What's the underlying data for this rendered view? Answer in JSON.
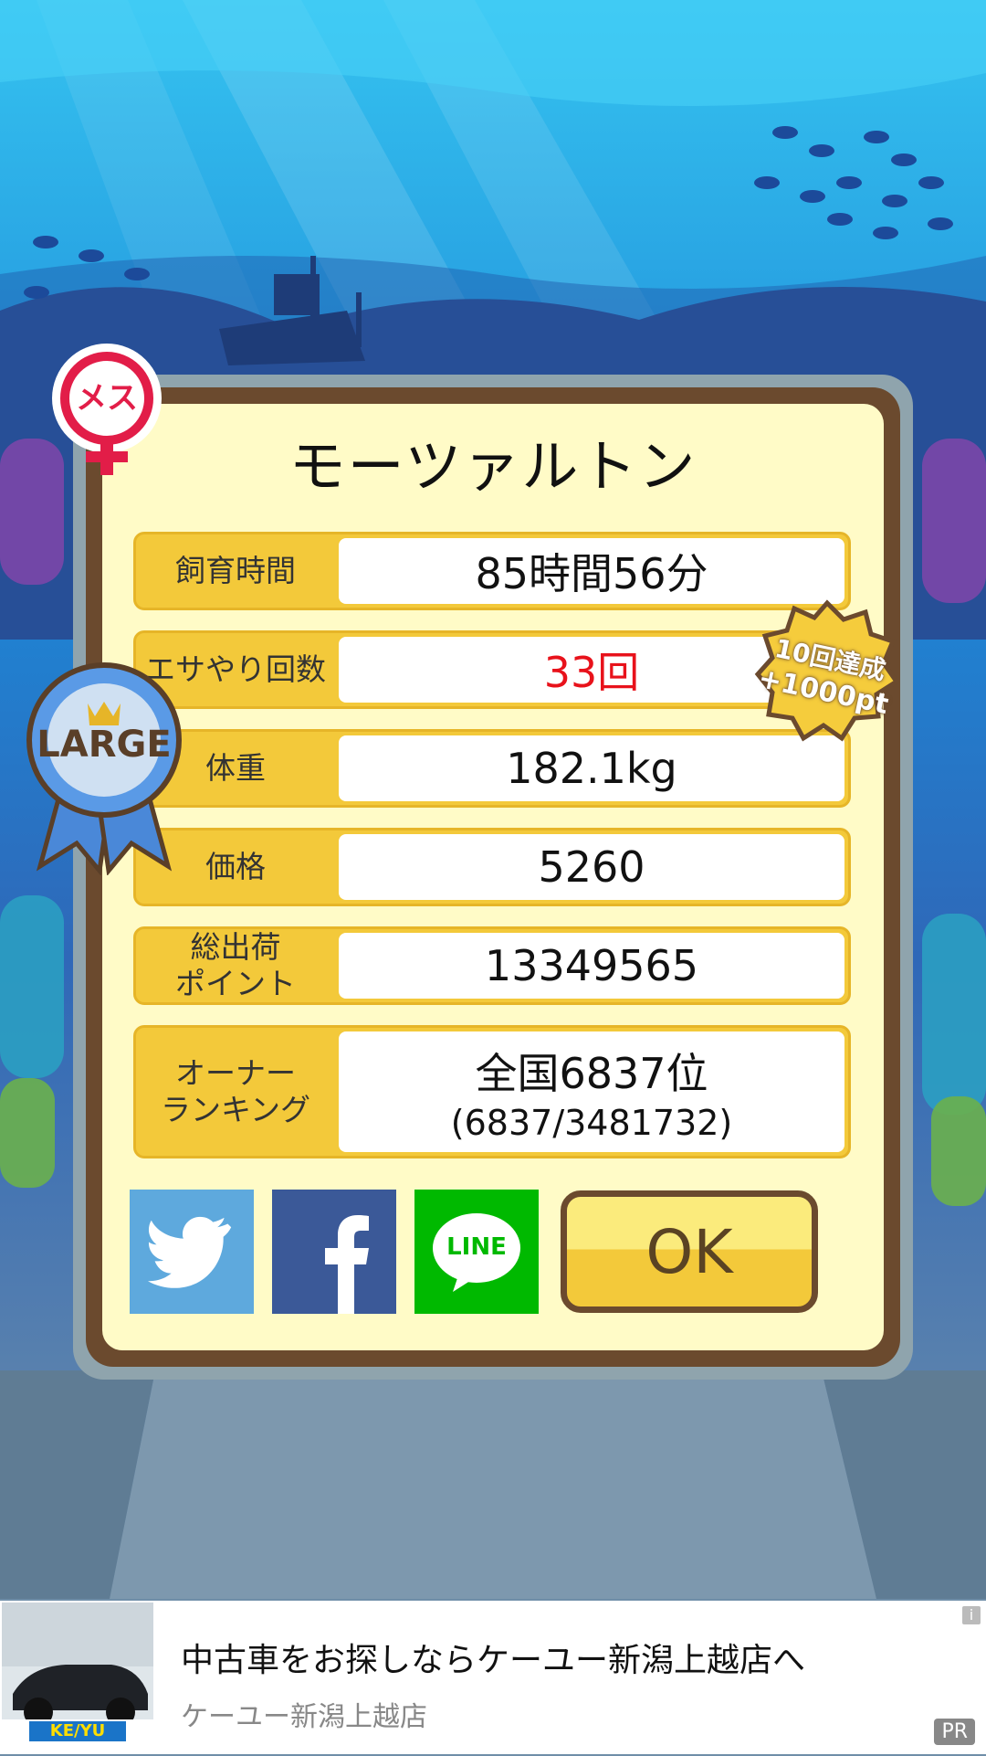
{
  "fish": {
    "name": "モーツァルトン",
    "gender_badge": "メス",
    "size_badge": "LARGE"
  },
  "bonus_badge": {
    "line1": "10回達成",
    "line2": "+1000pt"
  },
  "stats": [
    {
      "label": "飼育時間",
      "value": "85時間56分"
    },
    {
      "label": "エサやり回数",
      "value": "33回"
    },
    {
      "label": "体重",
      "value": "182.1kg"
    },
    {
      "label": "価格",
      "value": "5260"
    },
    {
      "label_line1": "総出荷",
      "label_line2": "ポイント",
      "value": "13349565"
    },
    {
      "label_line1": "オーナー",
      "label_line2": "ランキング",
      "value": "全国6837位",
      "value_sub": "(6837/3481732)"
    }
  ],
  "share": {
    "twitter_icon": "twitter-bird-icon",
    "facebook_icon": "facebook-f-icon",
    "line_icon": "line-icon",
    "line_text": "LINE"
  },
  "ok_label": "OK",
  "ad": {
    "headline": "中古車をお探しならケーユー新潟上越店へ",
    "advertiser": "ケーユー新潟上越店",
    "logo_text": "KE/YU",
    "pr_label": "PR",
    "info_label": "i"
  },
  "colors": {
    "accent_yellow": "#f3c93a",
    "panel_cream": "#fffbc7",
    "frame_brown": "#6b4a2e",
    "highlight_red": "#e8121b",
    "twitter_blue": "#5ea9dd",
    "facebook_blue": "#3b5998",
    "line_green": "#00b900"
  }
}
